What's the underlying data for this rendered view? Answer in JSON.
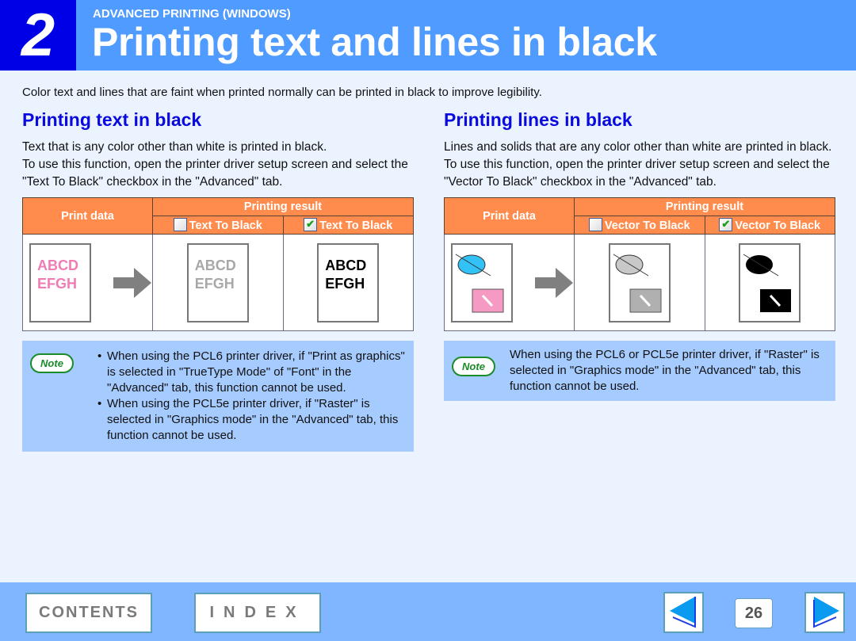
{
  "header": {
    "chapter_number": "2",
    "section_label": "ADVANCED PRINTING (WINDOWS)",
    "title": "Printing text and lines in black"
  },
  "intro": "Color text and lines that are faint when printed normally can be printed in black to improve legibility.",
  "text_section": {
    "title": "Printing text in black",
    "paragraphs": [
      "Text that is any color other than white is printed in black.",
      "To use this function, open the printer driver setup screen and select the \"Text To Black\" checkbox in the \"Advanced\" tab."
    ],
    "table": {
      "col_print_data": "Print data",
      "col_printing_result": "Printing result",
      "option_unchecked": "Text To Black",
      "option_checked": "Text To Black",
      "sample_line1": "ABCD",
      "sample_line2": "EFGH",
      "colors": {
        "original": "#f07cb4",
        "unchecked": "#a8a8a8",
        "checked": "#000000"
      }
    },
    "note": {
      "badge": "Note",
      "items": [
        "When using the PCL6 printer driver, if \"Print as graphics\" is selected in \"TrueType Mode\" of \"Font\" in the \"Advanced\" tab, this function cannot be used.",
        "When using the PCL5e printer driver, if \"Raster\" is selected in \"Graphics mode\" in the \"Advanced\" tab, this function cannot be used."
      ]
    }
  },
  "lines_section": {
    "title": "Printing lines in black",
    "paragraphs": [
      "Lines and solids that are any color other than white are printed in black.",
      "To use this function, open the printer driver setup screen and select the \"Vector To Black\" checkbox in the \"Advanced\" tab."
    ],
    "table": {
      "col_print_data": "Print data",
      "col_printing_result": "Printing result",
      "option_unchecked": "Vector To Black",
      "option_checked": "Vector To Black",
      "colors": {
        "original_ellipse": "#33c2f5",
        "original_rect": "#f59ac2",
        "unchecked_ellipse": "#c8c8c8",
        "unchecked_rect": "#b0b0b0",
        "checked_ellipse": "#000000",
        "checked_rect": "#000000"
      }
    },
    "note": {
      "badge": "Note",
      "text": "When using the PCL6 or PCL5e printer driver, if \"Raster\" is selected in \"Graphics mode\" in the \"Advanced\" tab, this function cannot be used."
    }
  },
  "footer": {
    "contents_label": "CONTENTS",
    "index_label": "INDEX",
    "page_number": "26",
    "prev_icon": "left-triangle",
    "next_icon": "right-triangle"
  }
}
